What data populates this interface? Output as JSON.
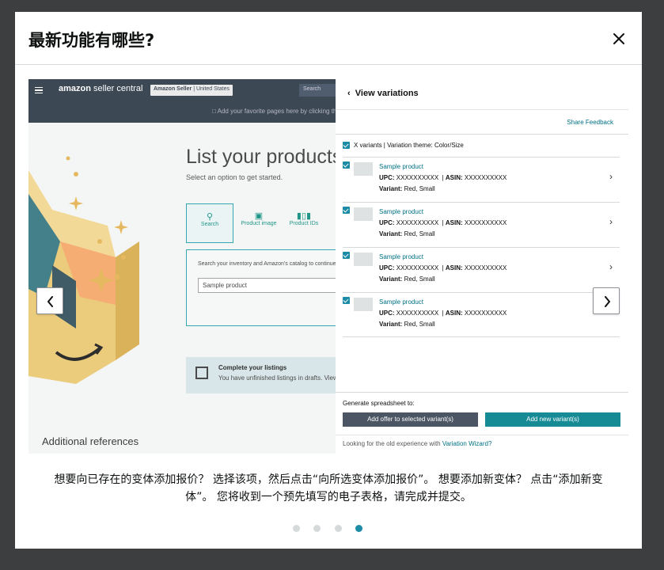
{
  "modal": {
    "title": "最新功能有哪些?"
  },
  "slide": {
    "header": {
      "logo_bold": "amazon",
      "logo_rest": " seller central",
      "account_bold": "Amazon Seller",
      "account_rest": " | United States",
      "search_placeholder": "Search",
      "favorites_hint": "Add your favorite pages here by clicking this icon"
    },
    "page": {
      "title": "List your products",
      "subtitle": "Select an option to get started.",
      "tabs": [
        {
          "label": "Search",
          "icon": "search-icon"
        },
        {
          "label": "Product image",
          "icon": "camera-icon"
        },
        {
          "label": "Product IDs",
          "icon": "barcode-icon"
        }
      ],
      "search_label": "Search your inventory and Amazon's catalog to continue",
      "search_value": "Sample product",
      "complete_title": "Complete your listings",
      "complete_text": "You have unfinished listings in drafts. View drafts",
      "additional_refs": "Additional references"
    },
    "panel": {
      "title": "View variations",
      "share_feedback": "Share Feedback",
      "variants_theme": "X variants | Variation theme: Color/Size",
      "rows": [
        {
          "name": "Sample product",
          "upc_label": "UPC:",
          "upc": "XXXXXXXXXX",
          "asin_label": "ASIN:",
          "asin": "XXXXXXXXXX",
          "variant_label": "Variant:",
          "variant": "Red, Small"
        },
        {
          "name": "Sample product",
          "upc_label": "UPC:",
          "upc": "XXXXXXXXXX",
          "asin_label": "ASIN:",
          "asin": "XXXXXXXXXX",
          "variant_label": "Variant:",
          "variant": "Red, Small"
        },
        {
          "name": "Sample product",
          "upc_label": "UPC:",
          "upc": "XXXXXXXXXX",
          "asin_label": "ASIN:",
          "asin": "XXXXXXXXXX",
          "variant_label": "Variant:",
          "variant": "Red, Small"
        },
        {
          "name": "Sample product",
          "upc_label": "UPC:",
          "upc": "XXXXXXXXXX",
          "asin_label": "ASIN:",
          "asin": "XXXXXXXXXX",
          "variant_label": "Variant:",
          "variant": "Red, Small"
        }
      ],
      "generate_label": "Generate spreadsheet to:",
      "btn_add_offer": "Add offer to selected variant(s)",
      "btn_add_variant": "Add new variant(s)",
      "old_text": "Looking for the old experience with ",
      "old_link": "Variation Wizard?"
    }
  },
  "caption": "想要向已存在的变体添加报价？ 选择该项，然后点击“向所选变体添加报价”。 想要添加新变体？ 点击“添加新变体”。 您将收到一个预先填写的电子表格，请完成并提交。",
  "carousel": {
    "total": 4,
    "active_index": 3
  },
  "colors": {
    "accent": "#1b8ba6",
    "overlay": "#3d3e40",
    "header_bg": "#232f3e"
  }
}
